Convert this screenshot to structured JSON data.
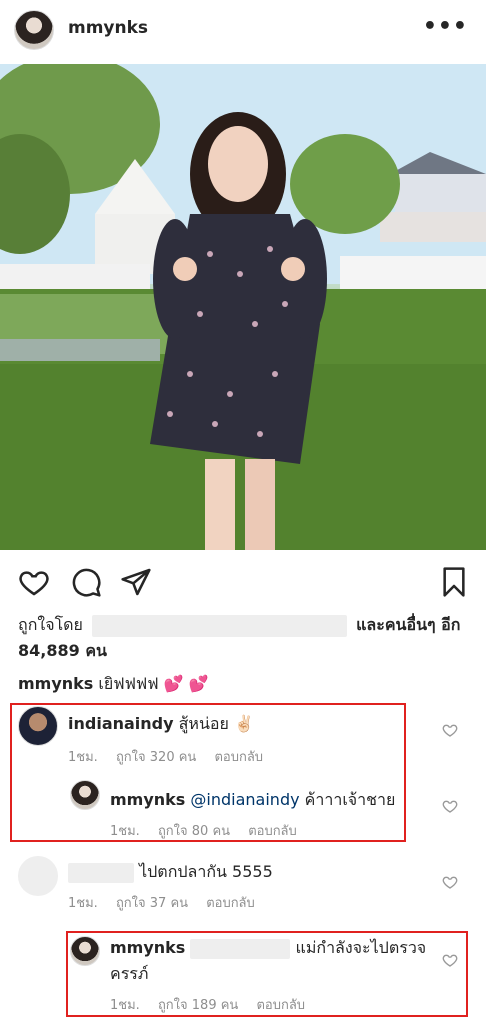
{
  "post": {
    "username": "mmynks",
    "more_icon": "more-horizontal-icon"
  },
  "actions": {
    "like_icon": "heart-icon",
    "comment_icon": "comment-icon",
    "share_icon": "paper-plane-icon",
    "save_icon": "bookmark-icon"
  },
  "likes": {
    "prefix": "ถูกใจโดย",
    "suffix": "และคนอื่นๆ อีก",
    "count": "84,889 คน"
  },
  "caption": {
    "username": "mmynks",
    "text": "เยิฟฟฟฟ",
    "emoji": "💕 💕"
  },
  "comments": [
    {
      "username": "indianaindy",
      "text": "สู้หน่อย ✌🏻",
      "time": "1ชม.",
      "likes": "ถูกใจ 320 คน",
      "reply": "ตอบกลับ"
    },
    {
      "username": "mmynks",
      "mention": "@indianaindy",
      "text": "ค้าาาเจ้าชาย",
      "time": "1ชม.",
      "likes": "ถูกใจ 80 คน",
      "reply": "ตอบกลับ"
    },
    {
      "text": "ไปตกปลากัน 5555",
      "time": "1ชม.",
      "likes": "ถูกใจ 37 คน",
      "reply": "ตอบกลับ"
    },
    {
      "username": "mmynks",
      "text_line1": "แม่กำลังจะไปตรวจ",
      "text_line2": "ครรภ์",
      "time": "1ชม.",
      "likes": "ถูกใจ 189 คน",
      "reply": "ตอบกลับ"
    }
  ],
  "colors": {
    "highlight_border": "#e0211f",
    "text": "#262626",
    "meta": "#8e8e8e",
    "mention": "#003569"
  }
}
